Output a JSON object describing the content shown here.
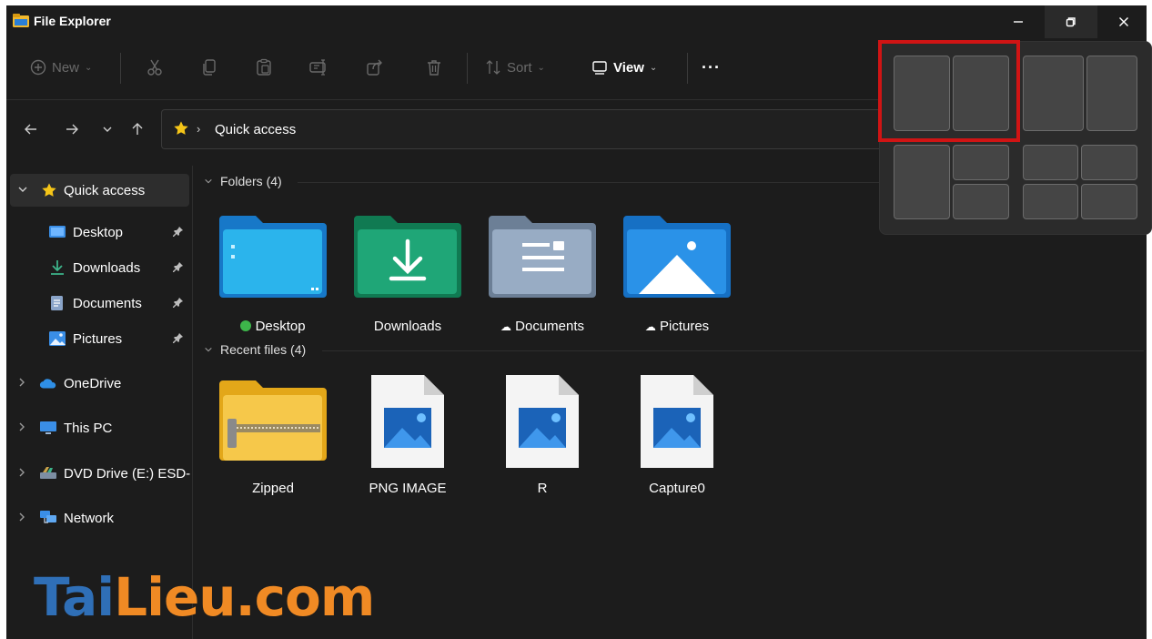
{
  "window": {
    "title": "File Explorer"
  },
  "title_buttons": {
    "minimize": "minimize-icon",
    "restore": "restore-icon",
    "close": "close-icon"
  },
  "toolbar": {
    "new_label": "New",
    "sort_label": "Sort",
    "view_label": "View",
    "more_label": "···",
    "icons": [
      "cut-icon",
      "copy-icon",
      "paste-icon",
      "rename-icon",
      "share-icon",
      "delete-icon"
    ]
  },
  "address": {
    "path": "Quick access"
  },
  "sidebar": {
    "items": [
      {
        "label": "Quick access",
        "icon": "star-icon"
      },
      {
        "label": "Desktop",
        "icon": "desktop-icon"
      },
      {
        "label": "Downloads",
        "icon": "download-icon"
      },
      {
        "label": "Documents",
        "icon": "documents-icon"
      },
      {
        "label": "Pictures",
        "icon": "pictures-icon"
      },
      {
        "label": "OneDrive",
        "icon": "cloud-icon"
      },
      {
        "label": "This PC",
        "icon": "computer-icon"
      },
      {
        "label": "DVD Drive (E:) ESD-",
        "icon": "dvd-icon"
      },
      {
        "label": "Network",
        "icon": "network-icon"
      }
    ]
  },
  "folders": {
    "header": "Folders (4)",
    "items": [
      {
        "name": "Desktop",
        "status": "synced"
      },
      {
        "name": "Downloads",
        "status": ""
      },
      {
        "name": "Documents",
        "status": "cloud"
      },
      {
        "name": "Pictures",
        "status": "cloud"
      }
    ]
  },
  "recent": {
    "header": "Recent files (4)",
    "items": [
      {
        "name": "Zipped"
      },
      {
        "name": "PNG IMAGE"
      },
      {
        "name": "R"
      },
      {
        "name": "Capture0"
      }
    ]
  },
  "snap_layouts": {
    "highlighted": "two-column-equal"
  },
  "watermark": {
    "part1": "Tai",
    "part2": "Lieu",
    "part3": ".com"
  },
  "colors": {
    "background": "#1c1c1c",
    "accent_star": "#f5c518",
    "folder_blue": "#2aa3e8",
    "folder_green": "#1e9e6e",
    "highlight_red": "#d01414",
    "watermark_blue": "#2f6fb7",
    "watermark_orange": "#f08a24"
  }
}
